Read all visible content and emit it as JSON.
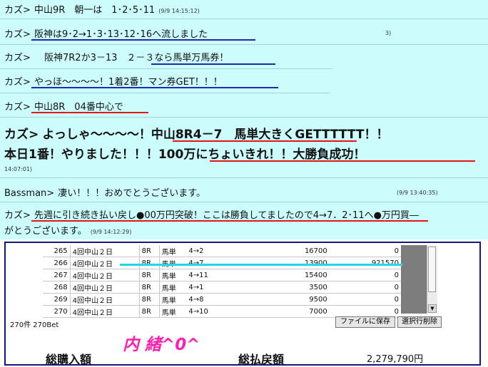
{
  "chat": {
    "messages": [
      {
        "user": "カズ>",
        "text": "中山9R　朝一は　1･2･5･11",
        "time": "(9/9 14:15:12)"
      },
      {
        "user": "カズ>",
        "text": "阪神は9･2→1･3･13･12･16へ流しました",
        "time": "3)"
      },
      {
        "user": "カズ>",
        "text": "阪神7R2か3－13　２－３なら馬単万馬券！"
      },
      {
        "user": "カズ>",
        "text": "やっほ～～～～！1着2番！マン券GET！！！"
      },
      {
        "user": "カズ>",
        "text": "中山8R　04番中心で"
      },
      {
        "user": "カズ>",
        "text_line1": "よっしゃ～～～～！中山8R4－7　馬単大きくGETTTTTT！！",
        "text_line2": "本日1番！やりました！！！100万にちょいきれ！！大勝負成功！",
        "time": "14:07:01)"
      },
      {
        "user": "Bassman>",
        "text": "凄い！！！おめでとうございます。",
        "time": "(9/9 13:40:35)"
      },
      {
        "user": "カズ>",
        "text_line1": "先週に引き続き払い戻し●00万円突破！ここは勝負してましたので4→7．2･11へ●万円買―",
        "text_line2": "がとうございます。",
        "time": "(9/9 14:12:29)"
      }
    ]
  },
  "panel": {
    "rows": [
      {
        "no": "265",
        "place": "4回中山２日",
        "race": "8R",
        "type": "馬単",
        "combo": "4→2",
        "bet": "16700",
        "payout": "0"
      },
      {
        "no": "266",
        "place": "4回中山２日",
        "race": "8R",
        "type": "馬単",
        "combo": "4→7",
        "bet": "13900",
        "payout": "921570"
      },
      {
        "no": "267",
        "place": "4回中山２日",
        "race": "8R",
        "type": "馬単",
        "combo": "4→11",
        "bet": "15400",
        "payout": "0"
      },
      {
        "no": "268",
        "place": "4回中山２日",
        "race": "8R",
        "type": "馬単",
        "combo": "4→1",
        "bet": "3500",
        "payout": "0"
      },
      {
        "no": "269",
        "place": "4回中山２日",
        "race": "8R",
        "type": "馬単",
        "combo": "4→8",
        "bet": "9500",
        "payout": "0"
      },
      {
        "no": "270",
        "place": "4回中山２日",
        "race": "8R",
        "type": "馬単",
        "combo": "4→10",
        "bet": "7000",
        "payout": "0"
      }
    ],
    "count_label": "270件 270Bet",
    "save_button": "ファイルに保存",
    "delete_button": "選択行削除",
    "overlay_text": "内 緒^0^",
    "total_purchase_label": "総購入額",
    "total_payout_label": "総払戻額",
    "total_payout_value": "2,279,790円"
  },
  "colors": {
    "chat_bg": "#ccfcfc",
    "underline_red": "#e01818",
    "underline_blue": "#1a2aa8",
    "overlay_pink": "#ff1fb0",
    "highlight_cyan": "#20d8e8"
  }
}
